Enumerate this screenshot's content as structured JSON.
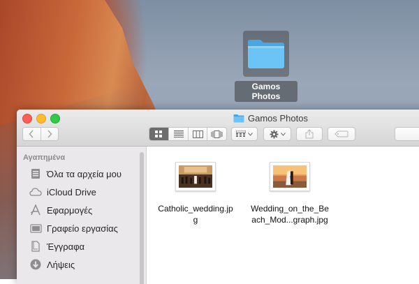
{
  "desktop": {
    "folder_label": "Gamos Photos"
  },
  "window": {
    "title": "Gamos Photos",
    "toolbar": {
      "back_icon": "chevron-left-icon",
      "forward_icon": "chevron-right-icon",
      "view_modes": [
        "icon-view",
        "list-view",
        "column-view",
        "cover-flow-view"
      ],
      "active_view": "icon-view"
    },
    "sidebar": {
      "heading": "Αγαπημένα",
      "items": [
        {
          "label": "Όλα τα αρχεία μου",
          "icon": "all-files-icon"
        },
        {
          "label": "iCloud Drive",
          "icon": "cloud-icon"
        },
        {
          "label": "Εφαρμογές",
          "icon": "applications-icon"
        },
        {
          "label": "Γραφείο εργασίας",
          "icon": "desktop-icon"
        },
        {
          "label": "Έγγραφα",
          "icon": "documents-icon"
        },
        {
          "label": "Λήψεις",
          "icon": "downloads-icon"
        }
      ]
    },
    "files": [
      {
        "name_line1": "Catholic_wedding.jp",
        "name_line2": "g"
      },
      {
        "name_line1": "Wedding_on_the_Be",
        "name_line2": "ach_Mod...graph.jpg"
      }
    ]
  },
  "colors": {
    "folder_blue": "#5ab8f0",
    "close": "#fc5f57",
    "minimize": "#fdbc2e",
    "maximize": "#34c84a"
  }
}
